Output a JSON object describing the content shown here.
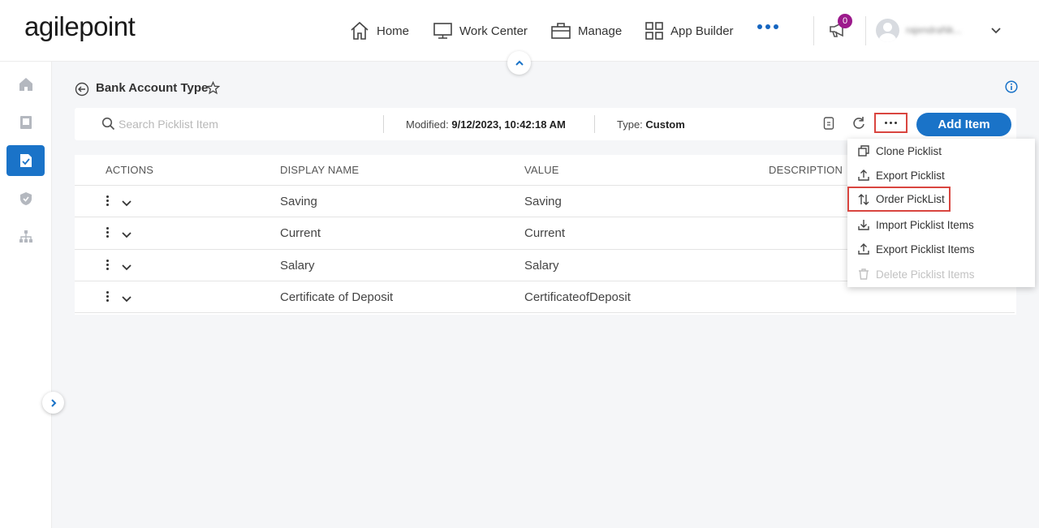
{
  "brand": {
    "logo_text": "agilepoint"
  },
  "nav": {
    "home": "Home",
    "work_center": "Work Center",
    "manage": "Manage",
    "app_builder": "App Builder"
  },
  "notifications": {
    "count": "0"
  },
  "user": {
    "name": "rajendraNk..."
  },
  "page": {
    "title": "Bank Account Type"
  },
  "toolbar": {
    "search_placeholder": "Search Picklist Item",
    "modified_label": "Modified:",
    "modified_value": "9/12/2023, 10:42:18 AM",
    "type_label": "Type:",
    "type_value": "Custom",
    "add_label": "Add Item"
  },
  "table": {
    "headers": {
      "actions": "ACTIONS",
      "display_name": "DISPLAY NAME",
      "value": "VALUE",
      "description": "DESCRIPTION"
    },
    "rows": [
      {
        "display_name": "Saving",
        "value": "Saving"
      },
      {
        "display_name": "Current",
        "value": "Current"
      },
      {
        "display_name": "Salary",
        "value": "Salary"
      },
      {
        "display_name": "Certificate of Deposit",
        "value": "CertificateofDeposit"
      }
    ]
  },
  "menu": {
    "items": [
      {
        "label": "Clone Picklist",
        "icon": "clone-icon"
      },
      {
        "label": "Export Picklist",
        "icon": "export-icon"
      },
      {
        "label": "Order PickList",
        "icon": "sort-icon"
      },
      {
        "label": "Import Picklist Items",
        "icon": "import-icon"
      },
      {
        "label": "Export Picklist Items",
        "icon": "export-icon"
      },
      {
        "label": "Delete Picklist Items",
        "icon": "trash-icon",
        "disabled": true
      }
    ]
  },
  "colors": {
    "accent": "#1a73c8",
    "badge": "#9c1a8c",
    "highlight_border": "#d9453f"
  }
}
